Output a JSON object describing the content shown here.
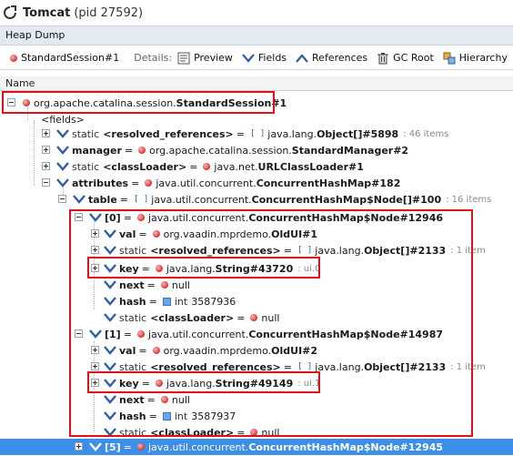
{
  "window": {
    "app_name": "Tomcat",
    "pid_text": "(pid 27592)"
  },
  "tab": {
    "label": "Heap Dump"
  },
  "toolbar": {
    "instance_label": "StandardSession#1",
    "details_label": "Details:",
    "preview_label": "Preview",
    "fields_label": "Fields",
    "references_label": "References",
    "gcroot_label": "GC Root",
    "hierarchy_label": "Hierarchy"
  },
  "column_header": {
    "name": "Name"
  },
  "tree": {
    "root": {
      "prefix": "org.apache.catalina.session.",
      "type": "StandardSession#1"
    },
    "fields_node": "<fields>",
    "resolved_refs": {
      "kw": "static",
      "name": "<resolved_references>",
      "prefix": "java.lang.",
      "type": "Object[]#5898",
      "meta": ": 46 items"
    },
    "manager": {
      "name": "manager",
      "prefix": "org.apache.catalina.session.",
      "type": "StandardManager#2"
    },
    "classloader": {
      "kw": "static",
      "name": "<classLoader>",
      "prefix": "java.net.",
      "type": "URLClassLoader#1"
    },
    "attributes": {
      "name": "attributes",
      "prefix": "java.util.concurrent.",
      "type": "ConcurrentHashMap#182"
    },
    "table": {
      "name": "table",
      "prefix": "java.util.concurrent.",
      "type": "ConcurrentHashMap$Node[]#100",
      "meta": ": 16 items"
    },
    "node0": {
      "index": "[0]",
      "prefix": "java.util.concurrent.",
      "type": "ConcurrentHashMap$Node#12946",
      "val": {
        "name": "val",
        "prefix": "org.vaadin.mprdemo.",
        "type": "OldUI#1"
      },
      "rr": {
        "kw": "static",
        "name": "<resolved_references>",
        "prefix": "java.lang.",
        "type": "Object[]#2133",
        "meta": ": 1 item"
      },
      "key": {
        "name": "key",
        "prefix": "java.lang.",
        "type": "String#43720",
        "meta": ": ui.0"
      },
      "next": {
        "name": "next",
        "value": "null"
      },
      "hash": {
        "name": "hash",
        "kw": "int",
        "value": "3587936"
      },
      "cl": {
        "kw": "static",
        "name": "<classLoader>",
        "value": "null"
      }
    },
    "node1": {
      "index": "[1]",
      "prefix": "java.util.concurrent.",
      "type": "ConcurrentHashMap$Node#14987",
      "val": {
        "name": "val",
        "prefix": "org.vaadin.mprdemo.",
        "type": "OldUI#2"
      },
      "rr": {
        "kw": "static",
        "name": "<resolved_references>",
        "prefix": "java.lang.",
        "type": "Object[]#2133",
        "meta": ": 1 item"
      },
      "key": {
        "name": "key",
        "prefix": "java.lang.",
        "type": "String#49149",
        "meta": ": ui.1"
      },
      "next": {
        "name": "next",
        "value": "null"
      },
      "hash": {
        "name": "hash",
        "kw": "int",
        "value": "3587937"
      },
      "cl": {
        "kw": "static",
        "name": "<classLoader>",
        "value": "null"
      }
    },
    "node5": {
      "index": "[5]",
      "prefix": "java.util.concurrent.",
      "type": "ConcurrentHashMap$Node#12945"
    }
  },
  "colors": {
    "selection": "#3d8ee6",
    "highlight_box": "#e0101a",
    "instance_dot": "#e04444",
    "primitive": "#6aa6e8"
  }
}
